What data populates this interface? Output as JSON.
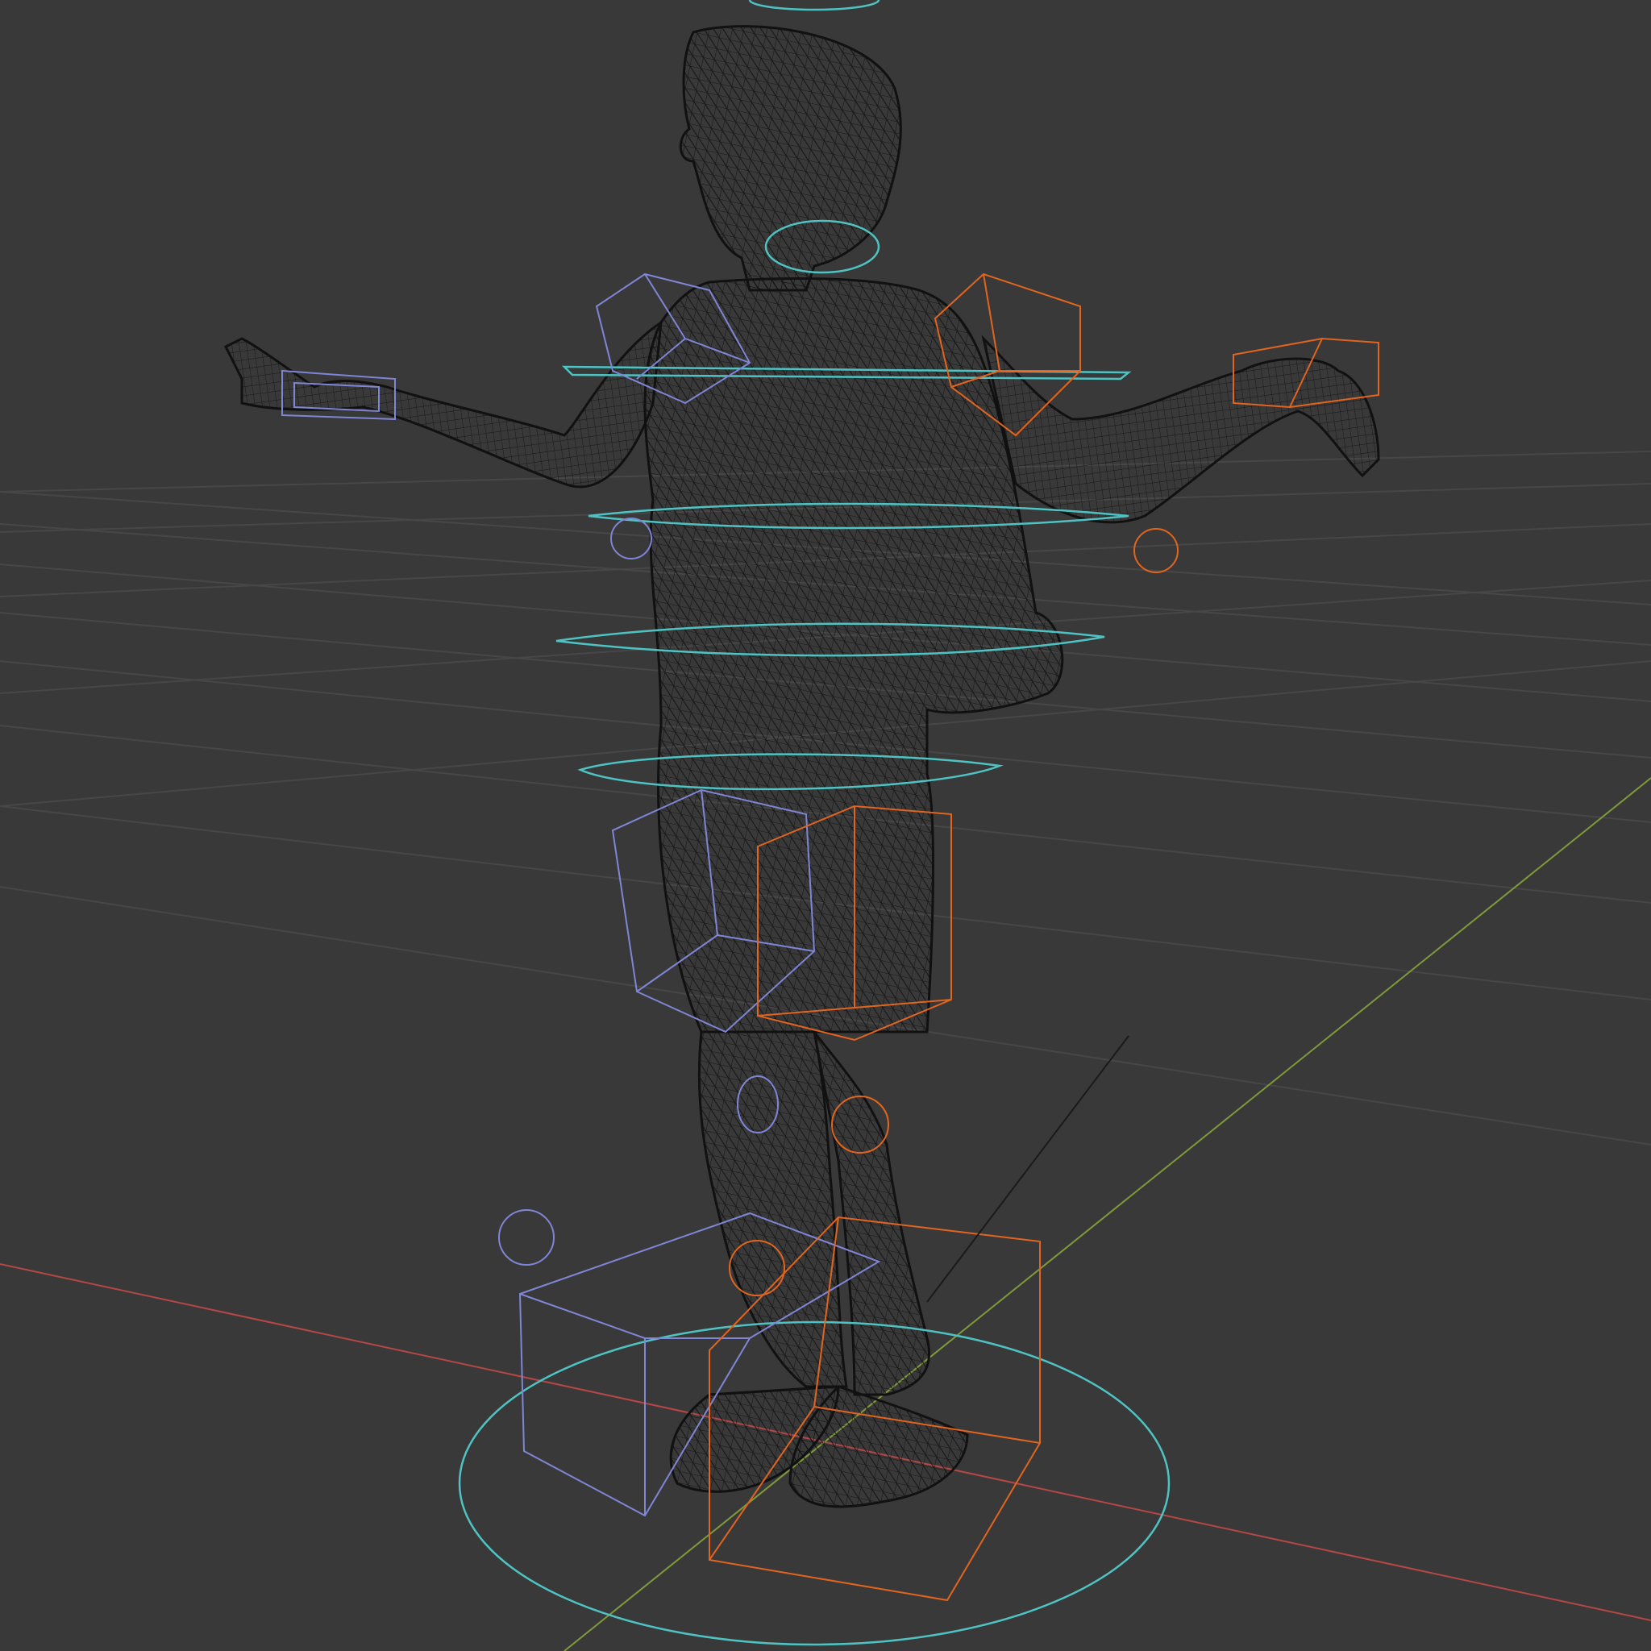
{
  "viewport": {
    "mode": "wireframe",
    "background": "#393939",
    "colors": {
      "grid_line": "#4a4a4a",
      "x_axis": "#b54747",
      "y_axis": "#7f9a3a",
      "mesh_wire": "#111111",
      "ctrl_center": "#4fc3c3",
      "ctrl_left": "#7f86d6",
      "ctrl_right": "#e2651f",
      "bone_line": "#1a1a1a"
    }
  },
  "scene": {
    "mesh": {
      "name": "character-mesh",
      "pose": "A-pose",
      "shown_as": "wireframe"
    },
    "rig": {
      "center_controls": [
        "head",
        "neck",
        "chest",
        "spine",
        "hips",
        "root"
      ],
      "left_controls": [
        "hand-ik",
        "shoulder",
        "elbow-pole",
        "hip-fk",
        "knee-pole",
        "foot-ik"
      ],
      "right_controls": [
        "hand-ik",
        "shoulder",
        "elbow-pole",
        "hip-fk",
        "knee-pole",
        "foot-ik"
      ]
    }
  }
}
